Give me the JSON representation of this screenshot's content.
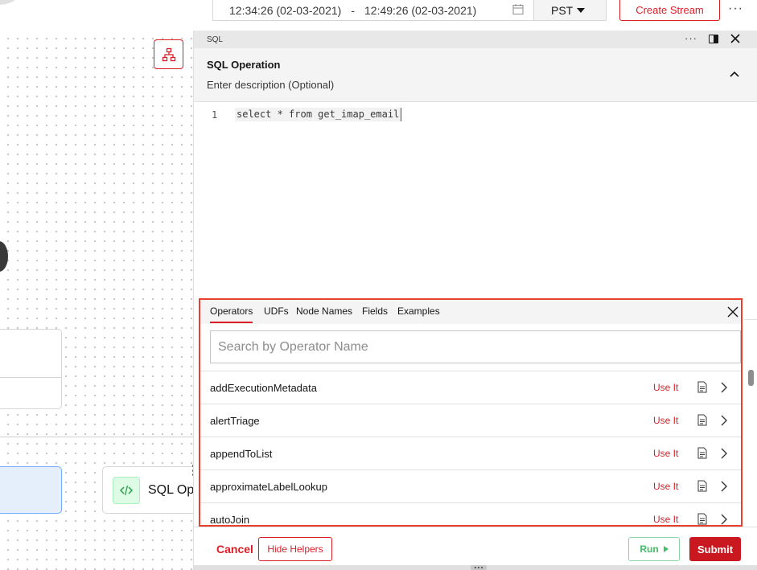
{
  "topbar": {
    "time_start": "12:34:26 (02-03-2021)",
    "separator": "-",
    "time_end": "12:49:26 (02-03-2021)",
    "timezone": "PST",
    "create_stream_label": "Create Stream",
    "more_label": "···"
  },
  "canvas": {
    "sql_node_label": "SQL Op"
  },
  "panel": {
    "header_label": "SQL",
    "operation_title": "SQL Operation",
    "description_placeholder": "Enter description (Optional)",
    "editor": {
      "line_number": "1",
      "code": "select * from get_imap_email"
    }
  },
  "helpers": {
    "tabs": [
      {
        "label": "Operators",
        "active": true
      },
      {
        "label": "UDFs",
        "active": false
      },
      {
        "label": "Node Names",
        "active": false
      },
      {
        "label": "Fields",
        "active": false
      },
      {
        "label": "Examples",
        "active": false
      }
    ],
    "search_placeholder": "Search by Operator Name",
    "use_it_label": "Use It",
    "operators": [
      "addExecutionMetadata",
      "alertTriage",
      "appendToList",
      "approximateLabelLookup",
      "autoJoin"
    ]
  },
  "footer": {
    "cancel_label": "Cancel",
    "hide_helpers_label": "Hide Helpers",
    "run_label": "Run",
    "submit_label": "Submit"
  },
  "colors": {
    "accent_red": "#da1e28",
    "success_green": "#42be65",
    "selected_blue": "#78a9ff"
  }
}
